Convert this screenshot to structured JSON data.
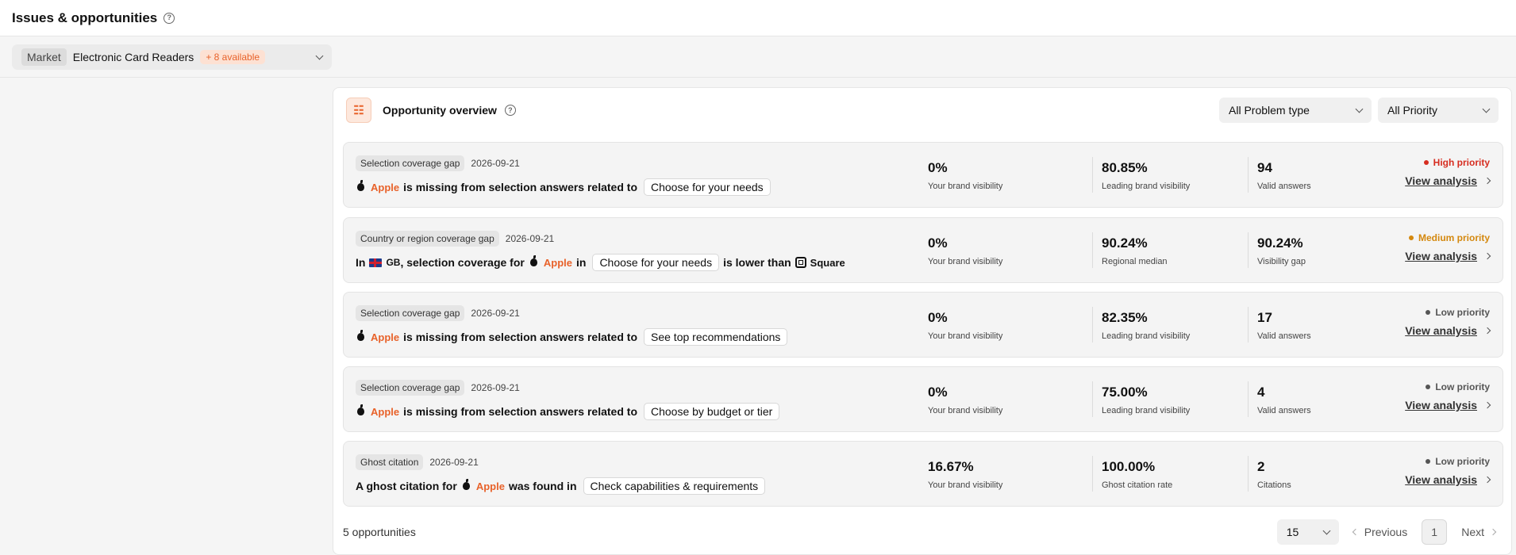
{
  "header": {
    "title": "Issues & opportunities",
    "help_glyph": "?"
  },
  "filter": {
    "market_tag": "Market",
    "market_value": "Electronic Card Readers",
    "available": "+ 8 available"
  },
  "overview": {
    "icon_glyph": "☷",
    "title": "Opportunity overview",
    "problem_filter": "All Problem type",
    "priority_filter": "All Priority"
  },
  "cards": [
    {
      "type": "Selection coverage gap",
      "date": "2026-09-21",
      "brand": "Apple",
      "text1": "is missing from selection answers related to",
      "chip": "Choose for your needs",
      "m1_val": "0%",
      "m1_lbl": "Your brand visibility",
      "m2_val": "80.85%",
      "m2_lbl": "Leading brand visibility",
      "m3_val": "94",
      "m3_lbl": "Valid answers",
      "priority": "High priority",
      "priority_color": "#d62d20",
      "view": "View analysis"
    },
    {
      "type": "Country or region coverage gap",
      "date": "2026-09-21",
      "prefix": "In",
      "country": "GB",
      "text_a": ", selection coverage for",
      "brand": "Apple",
      "text_b": "in",
      "chip": "Choose for your needs",
      "text_c": "is lower than",
      "competitor": "Square",
      "m1_val": "0%",
      "m1_lbl": "Your brand visibility",
      "m2_val": "90.24%",
      "m2_lbl": "Regional median",
      "m3_val": "90.24%",
      "m3_lbl": "Visibility gap",
      "priority": "Medium priority",
      "priority_color": "#d4880e",
      "view": "View analysis"
    },
    {
      "type": "Selection coverage gap",
      "date": "2026-09-21",
      "brand": "Apple",
      "text1": "is missing from selection answers related to",
      "chip": "See top recommendations",
      "m1_val": "0%",
      "m1_lbl": "Your brand visibility",
      "m2_val": "82.35%",
      "m2_lbl": "Leading brand visibility",
      "m3_val": "17",
      "m3_lbl": "Valid answers",
      "priority": "Low priority",
      "priority_color": "#555555",
      "view": "View analysis"
    },
    {
      "type": "Selection coverage gap",
      "date": "2026-09-21",
      "brand": "Apple",
      "text1": "is missing from selection answers related to",
      "chip": "Choose by budget or tier",
      "m1_val": "0%",
      "m1_lbl": "Your brand visibility",
      "m2_val": "75.00%",
      "m2_lbl": "Leading brand visibility",
      "m3_val": "4",
      "m3_lbl": "Valid answers",
      "priority": "Low priority",
      "priority_color": "#555555",
      "view": "View analysis"
    },
    {
      "type": "Ghost citation",
      "date": "2026-09-21",
      "prefix": "A ghost citation for",
      "brand": "Apple",
      "text1": "was found in",
      "chip": "Check capabilities & requirements",
      "m1_val": "16.67%",
      "m1_lbl": "Your brand visibility",
      "m2_val": "100.00%",
      "m2_lbl": "Ghost citation rate",
      "m3_val": "2",
      "m3_lbl": "Citations",
      "priority": "Low priority",
      "priority_color": "#555555",
      "view": "View analysis"
    }
  ],
  "footer": {
    "count": "5 opportunities",
    "page_size": "15",
    "previous": "Previous",
    "page": "1",
    "next": "Next"
  }
}
